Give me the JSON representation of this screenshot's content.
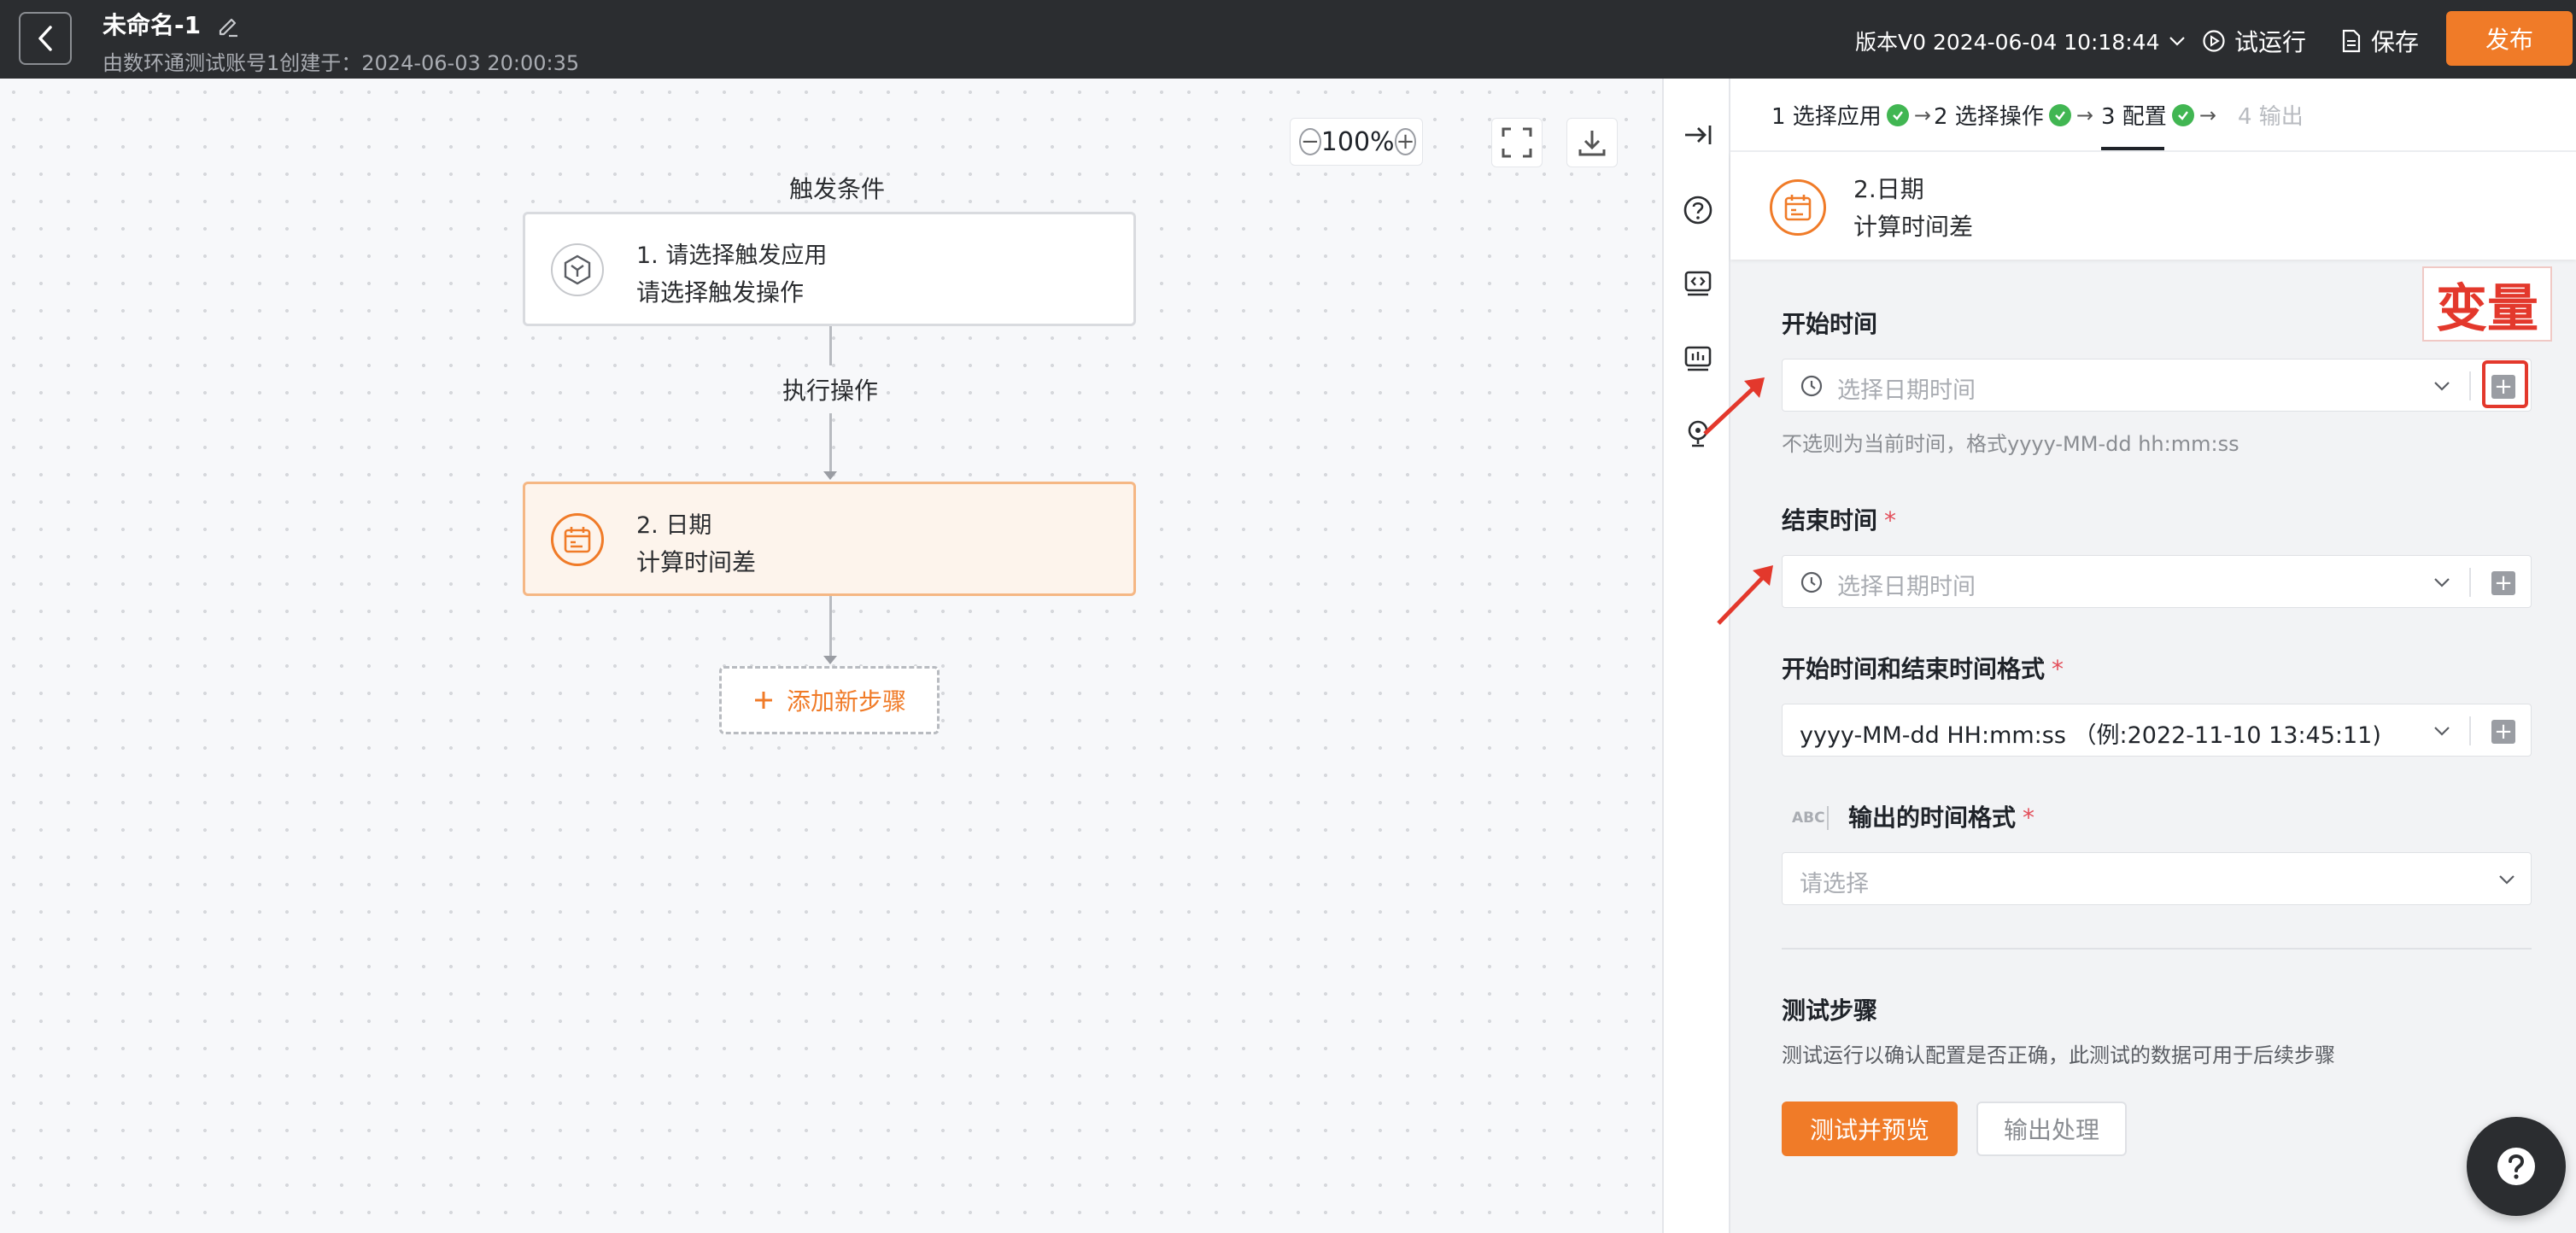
{
  "header": {
    "title": "未命名-1",
    "subtitle": "由数环通测试账号1创建于：2024-06-03 20:00:35",
    "version": "版本V0 2024-06-04 10:18:44",
    "trial_run": "试运行",
    "save": "保存",
    "publish": "发布"
  },
  "canvas": {
    "zoom": "100%",
    "trigger_label": "触发条件",
    "action_label": "执行操作",
    "node1": {
      "line1": "1. 请选择触发应用",
      "line2": "请选择触发操作"
    },
    "node2": {
      "line1": "2. 日期",
      "line2": "计算时间差"
    },
    "add_step": "添加新步骤"
  },
  "panel": {
    "steps": [
      {
        "label": "1 选择应用",
        "done": true
      },
      {
        "label": "2 选择操作",
        "done": true
      },
      {
        "label": "3 配置",
        "done": true
      },
      {
        "label": "4 输出",
        "done": false
      }
    ],
    "card": {
      "line1": "2.日期",
      "line2": "计算时间差"
    },
    "start_time": {
      "label": "开始时间",
      "placeholder": "选择日期时间",
      "hint": "不选则为当前时间，格式yyyy-MM-dd hh:mm:ss"
    },
    "end_time": {
      "label": "结束时间",
      "required": "*",
      "placeholder": "选择日期时间"
    },
    "format": {
      "label": "开始时间和结束时间格式",
      "required": "*",
      "value": "yyyy-MM-dd HH:mm:ss （例:2022-11-10 13:45:11)"
    },
    "output_format": {
      "type_tag": "ABC",
      "label": "输出的时间格式",
      "required": "*",
      "placeholder": "请选择"
    },
    "test": {
      "title": "测试步骤",
      "desc": "测试运行以确认配置是否正确，此测试的数据可用于后续步骤",
      "primary": "测试并预览",
      "secondary": "输出处理"
    }
  },
  "annotation": {
    "text": "变量",
    "color": "#e3382c"
  },
  "colors": {
    "accent": "#f07b28",
    "topbar": "#2b2d30",
    "success": "#41b652"
  }
}
